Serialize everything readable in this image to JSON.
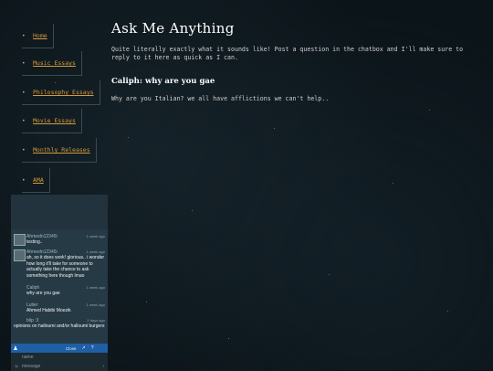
{
  "nav": {
    "items": [
      {
        "label": "Home"
      },
      {
        "label": "Music Essays"
      },
      {
        "label": "Philosophy Essays"
      },
      {
        "label": "Movie Essays"
      },
      {
        "label": "Monthly Releases"
      },
      {
        "label": "AMA"
      }
    ],
    "bullet": "•"
  },
  "main": {
    "title": "Ask Me Anything",
    "description": "Quite literally exactly what it sounds like! Post a question in the chatbox and I'll make sure to reply to it here as quick as I can.",
    "question_title": "Caliph: why are you gae",
    "question_answer": "Why are you Italian? we all have afflictions we can't help.."
  },
  "chat": {
    "messages": [
      {
        "name": "Ahmedn12345i",
        "time": "1 week ago",
        "body": "testing.."
      },
      {
        "name": "Ahmedn12345i",
        "time": "1 week ago",
        "body": "ah, so it does work! glorious.. i wonder how long it'll take for someone to actually take the chance to ask something here though lmao"
      },
      {
        "name": "Caliph",
        "time": "1 week ago",
        "body": "why are you gae"
      },
      {
        "name": "Lutier",
        "time": "1 week ago",
        "body": "Ahmed Habibi Moezik"
      },
      {
        "name": "blip :3",
        "time": "2 days ago",
        "body": "opinions on halloumi and/or halloumi burgers"
      }
    ],
    "bar": {
      "close_label": "Close"
    },
    "name_placeholder": "name",
    "message_placeholder": "message"
  },
  "colors": {
    "link": "#d69a3c",
    "chat_bar": "#1f5fa5",
    "chat_bg": "#263a45"
  }
}
